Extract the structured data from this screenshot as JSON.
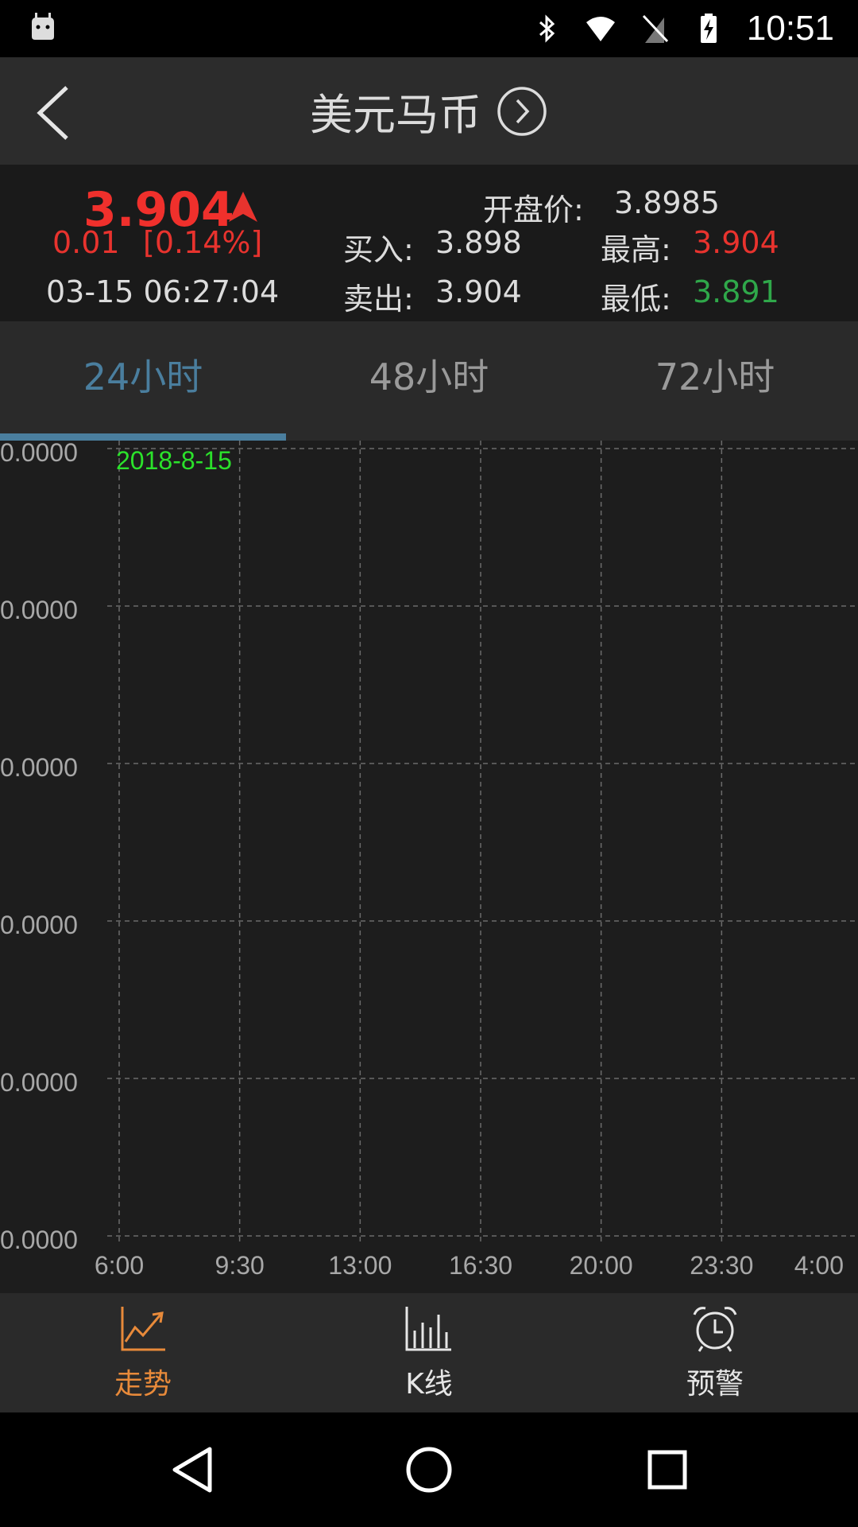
{
  "status_bar": {
    "time": "10:51",
    "icons": [
      "android-icon",
      "bluetooth-icon",
      "wifi-icon",
      "no-sim-icon",
      "battery-charging-icon"
    ]
  },
  "header": {
    "back_icon": "chevron-left-icon",
    "title": "美元马币",
    "title_icon": "circle-chevron-right-icon"
  },
  "quote": {
    "price": "3.904",
    "change": "0.01",
    "change_pct": "[0.14%]",
    "datetime": "03-15 06:27:04",
    "open_label": "开盘价:",
    "open_value": "3.8985",
    "buy_label": "买入:",
    "buy_value": "3.898",
    "sell_label": "卖出:",
    "sell_value": "3.904",
    "high_label": "最高:",
    "high_value": "3.904",
    "low_label": "最低:",
    "low_value": "3.891",
    "colors": {
      "up": "#e8332e",
      "down": "#2fa84a"
    }
  },
  "tabs": [
    {
      "label": "24小时",
      "active": true
    },
    {
      "label": "48小时",
      "active": false
    },
    {
      "label": "72小时",
      "active": false
    }
  ],
  "chart_data": {
    "type": "line",
    "date_label": "2018-8-15",
    "x_ticks": [
      "6:00",
      "9:30",
      "13:00",
      "16:30",
      "20:00",
      "23:30",
      "4:00"
    ],
    "y_ticks": [
      "0.0000",
      "0.0000",
      "0.0000",
      "0.0000",
      "0.0000",
      "0.0000"
    ],
    "series": [],
    "grid": true
  },
  "bottom_nav": [
    {
      "label": "走势",
      "icon": "trend-chart-icon",
      "active": true
    },
    {
      "label": "K线",
      "icon": "bar-chart-icon",
      "active": false
    },
    {
      "label": "预警",
      "icon": "alarm-clock-icon",
      "active": false
    }
  ],
  "system_nav": [
    "back-triangle-icon",
    "home-circle-icon",
    "recents-square-icon"
  ]
}
